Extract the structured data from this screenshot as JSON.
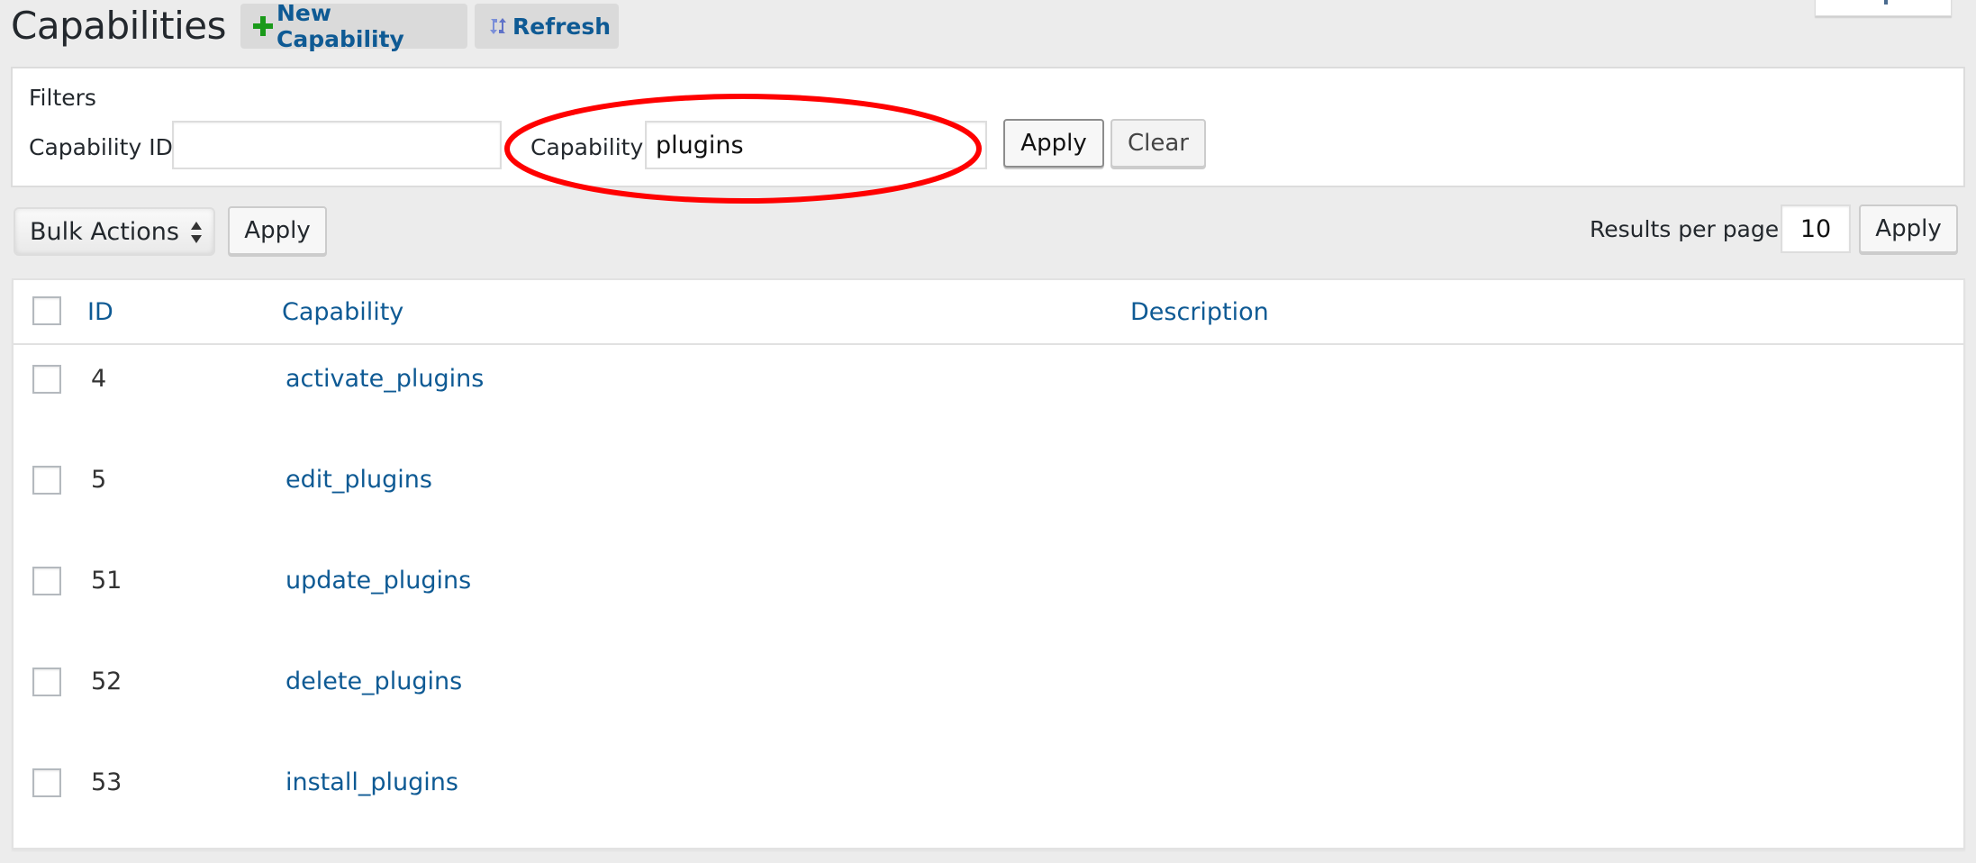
{
  "header": {
    "title": "Capabilities",
    "new_button": {
      "label": "New Capability",
      "icon": "plus-icon",
      "icon_color": "#1a9a1a"
    },
    "refresh_button": {
      "label": "Refresh",
      "icon": "refresh-icon",
      "icon_color": "#6b7fd0"
    }
  },
  "filters": {
    "title": "Filters",
    "capability_id": {
      "label": "Capability ID",
      "value": "",
      "placeholder": ""
    },
    "capability": {
      "label": "Capability",
      "value": "plugins",
      "placeholder": ""
    },
    "apply_label": "Apply",
    "clear_label": "Clear",
    "annotation_color": "#ff0000"
  },
  "toolbar": {
    "bulk_actions": {
      "selected": "Bulk Actions"
    },
    "bulk_apply_label": "Apply",
    "results_per_page_label": "Results per page",
    "results_per_page_value": "10",
    "rpp_apply_label": "Apply"
  },
  "table": {
    "columns": [
      {
        "key": "id",
        "label": "ID"
      },
      {
        "key": "capability",
        "label": "Capability"
      },
      {
        "key": "description",
        "label": "Description"
      }
    ],
    "rows": [
      {
        "id": "4",
        "capability": "activate_plugins",
        "description": ""
      },
      {
        "id": "5",
        "capability": "edit_plugins",
        "description": ""
      },
      {
        "id": "51",
        "capability": "update_plugins",
        "description": ""
      },
      {
        "id": "52",
        "capability": "delete_plugins",
        "description": ""
      },
      {
        "id": "53",
        "capability": "install_plugins",
        "description": ""
      }
    ]
  },
  "colors": {
    "link": "#0e5a94",
    "background": "#ececec",
    "panel": "#ffffff"
  }
}
